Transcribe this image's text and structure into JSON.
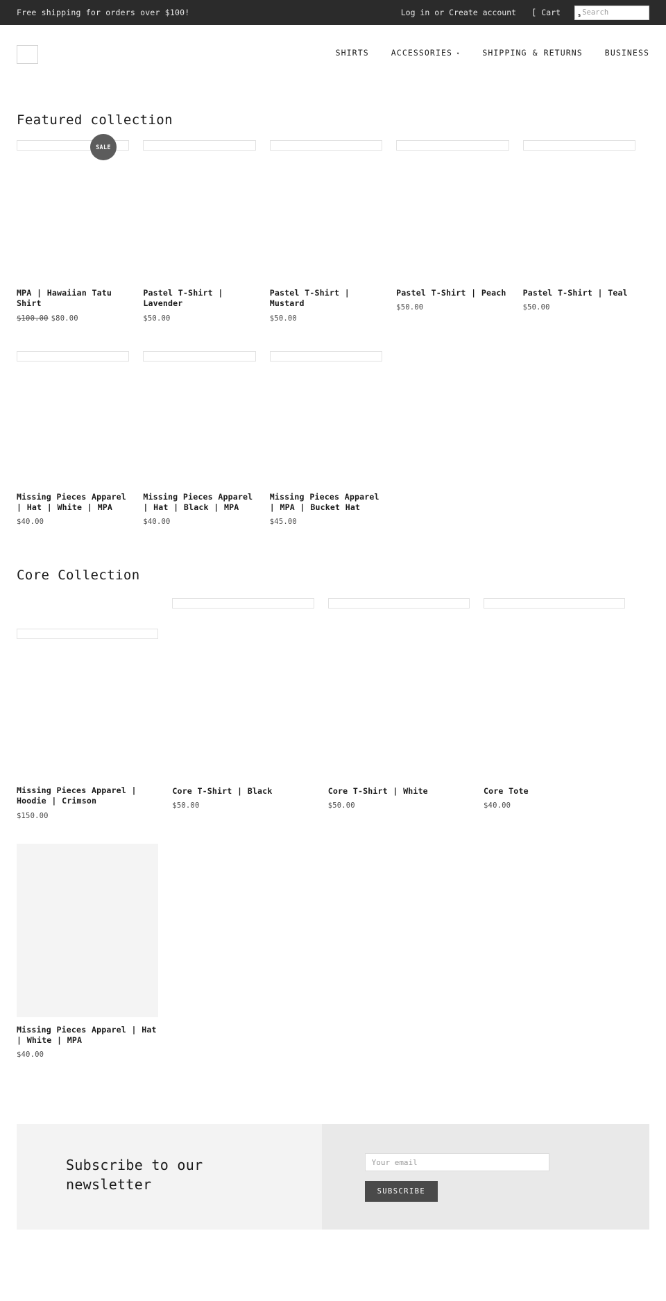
{
  "topbar": {
    "announcement": "Free shipping for orders over $100!",
    "login_label": "Log in",
    "or_label": "or",
    "create_account_label": "Create account",
    "cart_icon": "cart-icon",
    "cart_glyph": "[",
    "cart_label": "Cart",
    "search_icon": "search-icon",
    "search_glyph": "s",
    "search_placeholder": "Search",
    "search_value": "",
    "background": "#2b2b2b"
  },
  "header": {
    "logo_alt": "",
    "nav": [
      {
        "label": "SHIRTS",
        "has_caret": false,
        "caret": ""
      },
      {
        "label": "ACCESSORIES",
        "has_caret": true,
        "caret": "▾"
      },
      {
        "label": "SHIPPING & RETURNS",
        "has_caret": false,
        "caret": ""
      },
      {
        "label": "BUSINESS",
        "has_caret": false,
        "caret": ""
      }
    ]
  },
  "featured": {
    "title": "Featured collection",
    "sale_badge": "SALE",
    "row1": [
      {
        "title": "MPA | Hawaiian Tatu Shirt",
        "price_old": "$100.00",
        "price": "$80.00",
        "on_sale": true,
        "image": "broken"
      },
      {
        "title": "Pastel T-Shirt | Lavender",
        "price_old": "",
        "price": "$50.00",
        "on_sale": false,
        "image": "broken"
      },
      {
        "title": "Pastel T-Shirt | Mustard",
        "price_old": "",
        "price": "$50.00",
        "on_sale": false,
        "image": "broken"
      },
      {
        "title": "Pastel T-Shirt | Peach",
        "price_old": "",
        "price": "$50.00",
        "on_sale": false,
        "image": "broken"
      },
      {
        "title": "Pastel T-Shirt | Teal",
        "price_old": "",
        "price": "$50.00",
        "on_sale": false,
        "image": "broken"
      }
    ],
    "row2": [
      {
        "title": "Missing Pieces Apparel | Hat | White | MPA",
        "price_old": "",
        "price": "$40.00",
        "on_sale": false,
        "image": "broken"
      },
      {
        "title": "Missing Pieces Apparel | Hat | Black | MPA",
        "price_old": "",
        "price": "$40.00",
        "on_sale": false,
        "image": "broken"
      },
      {
        "title": "Missing Pieces Apparel | MPA | Bucket Hat",
        "price_old": "",
        "price": "$45.00",
        "on_sale": false,
        "image": "broken"
      }
    ]
  },
  "core": {
    "title": "Core Collection",
    "row1": [
      {
        "title": "Missing Pieces Apparel | Hoodie | Crimson",
        "price": "$150.00",
        "image": "broken"
      },
      {
        "title": "Core T-Shirt | Black",
        "price": "$50.00",
        "image": "broken"
      },
      {
        "title": "Core T-Shirt | White",
        "price": "$50.00",
        "image": "broken"
      },
      {
        "title": "Core Tote",
        "price": "$40.00",
        "image": "broken"
      }
    ],
    "row2": [
      {
        "title": "Missing Pieces Apparel | Hat | White | MPA",
        "price": "$40.00",
        "image": "block"
      }
    ]
  },
  "newsletter": {
    "heading": "Subscribe to our newsletter",
    "email_placeholder": "Your email",
    "email_value": "",
    "subscribe_label": "SUBSCRIBE",
    "left_bg": "#f3f3f3",
    "right_bg": "#e9e9e9",
    "button_bg": "#4a4a4a"
  }
}
